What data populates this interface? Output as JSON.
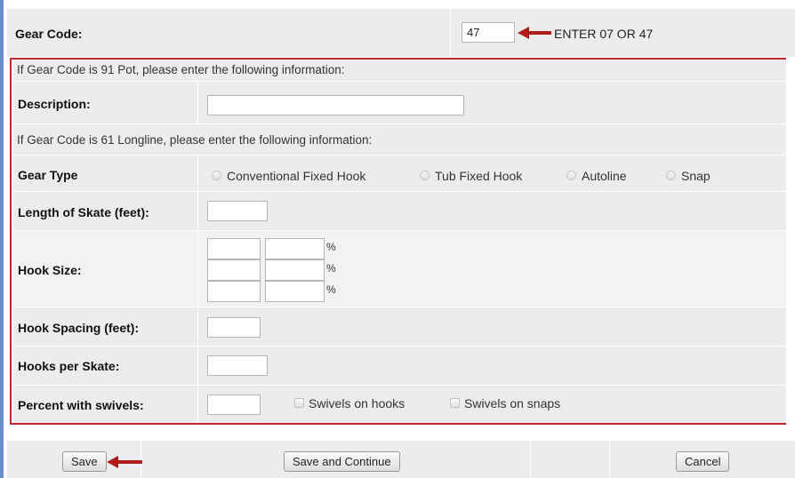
{
  "gear_code": {
    "label": "Gear Code:",
    "value": "47",
    "annotation": "ENTER 07 OR 47"
  },
  "pot_section": {
    "instruction": "If Gear Code is 91 Pot, please enter the following information:",
    "description_label": "Description:",
    "description_value": ""
  },
  "longline_section": {
    "instruction": "If Gear Code is 61 Longline, please enter the following information:",
    "gear_type_label": "Gear Type",
    "gear_type_options": [
      "Conventional Fixed Hook",
      "Tub Fixed Hook",
      "Autoline",
      "Snap"
    ],
    "length_of_skate_label": "Length of Skate (feet):",
    "hook_size_label": "Hook Size:",
    "percent_symbol": "%",
    "hook_spacing_label": "Hook Spacing (feet):",
    "hooks_per_skate_label": "Hooks per Skate:",
    "percent_swivels_label": "Percent with swivels:",
    "swivels_on_hooks_label": "Swivels on hooks",
    "swivels_on_snaps_label": "Swivels on snaps"
  },
  "buttons": {
    "save": "Save",
    "save_continue": "Save and Continue",
    "cancel": "Cancel"
  },
  "colors": {
    "highlight_box": "#c0282e",
    "arrow": "#b01c1c",
    "row_background": "#ececec"
  },
  "icons": [
    "red-arrow-icon",
    "radio-icon",
    "checkbox-icon"
  ]
}
